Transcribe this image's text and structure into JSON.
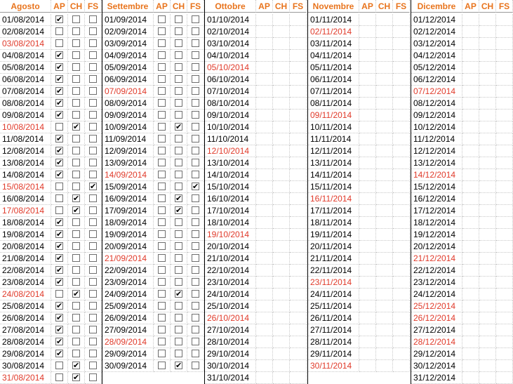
{
  "headers": {
    "months": [
      "Agosto",
      "Settembre",
      "Ottobre",
      "Novembre",
      "Dicembre"
    ],
    "flags": [
      "AP",
      "CH",
      "FS"
    ]
  },
  "colors": {
    "header_text": "#e8741d",
    "holiday_text": "#e03a2a",
    "date_text": "#000000"
  },
  "checkmark_glyph": "✔",
  "months": [
    {
      "name": "Agosto",
      "days": [
        {
          "date": "01/08/2014",
          "holiday": false,
          "checks": [
            true,
            false,
            false
          ]
        },
        {
          "date": "02/08/2014",
          "holiday": false,
          "checks": [
            false,
            false,
            false
          ]
        },
        {
          "date": "03/08/2014",
          "holiday": true,
          "checks": [
            false,
            false,
            false
          ]
        },
        {
          "date": "04/08/2014",
          "holiday": false,
          "checks": [
            true,
            false,
            false
          ]
        },
        {
          "date": "05/08/2014",
          "holiday": false,
          "checks": [
            true,
            false,
            false
          ]
        },
        {
          "date": "06/08/2014",
          "holiday": false,
          "checks": [
            true,
            false,
            false
          ]
        },
        {
          "date": "07/08/2014",
          "holiday": false,
          "checks": [
            true,
            false,
            false
          ]
        },
        {
          "date": "08/08/2014",
          "holiday": false,
          "checks": [
            true,
            false,
            false
          ]
        },
        {
          "date": "09/08/2014",
          "holiday": false,
          "checks": [
            true,
            false,
            false
          ]
        },
        {
          "date": "10/08/2014",
          "holiday": true,
          "checks": [
            false,
            true,
            false
          ]
        },
        {
          "date": "11/08/2014",
          "holiday": false,
          "checks": [
            true,
            false,
            false
          ]
        },
        {
          "date": "12/08/2014",
          "holiday": false,
          "checks": [
            true,
            false,
            false
          ]
        },
        {
          "date": "13/08/2014",
          "holiday": false,
          "checks": [
            true,
            false,
            false
          ]
        },
        {
          "date": "14/08/2014",
          "holiday": false,
          "checks": [
            true,
            false,
            false
          ]
        },
        {
          "date": "15/08/2014",
          "holiday": true,
          "checks": [
            false,
            false,
            true
          ]
        },
        {
          "date": "16/08/2014",
          "holiday": false,
          "checks": [
            false,
            true,
            false
          ]
        },
        {
          "date": "17/08/2014",
          "holiday": true,
          "checks": [
            false,
            true,
            false
          ]
        },
        {
          "date": "18/08/2014",
          "holiday": false,
          "checks": [
            true,
            false,
            false
          ]
        },
        {
          "date": "19/08/2014",
          "holiday": false,
          "checks": [
            true,
            false,
            false
          ]
        },
        {
          "date": "20/08/2014",
          "holiday": false,
          "checks": [
            true,
            false,
            false
          ]
        },
        {
          "date": "21/08/2014",
          "holiday": false,
          "checks": [
            true,
            false,
            false
          ]
        },
        {
          "date": "22/08/2014",
          "holiday": false,
          "checks": [
            true,
            false,
            false
          ]
        },
        {
          "date": "23/08/2014",
          "holiday": false,
          "checks": [
            true,
            false,
            false
          ]
        },
        {
          "date": "24/08/2014",
          "holiday": true,
          "checks": [
            false,
            true,
            false
          ]
        },
        {
          "date": "25/08/2014",
          "holiday": false,
          "checks": [
            true,
            false,
            false
          ]
        },
        {
          "date": "26/08/2014",
          "holiday": false,
          "checks": [
            true,
            false,
            false
          ]
        },
        {
          "date": "27/08/2014",
          "holiday": false,
          "checks": [
            true,
            false,
            false
          ]
        },
        {
          "date": "28/08/2014",
          "holiday": false,
          "checks": [
            true,
            false,
            false
          ]
        },
        {
          "date": "29/08/2014",
          "holiday": false,
          "checks": [
            true,
            false,
            false
          ]
        },
        {
          "date": "30/08/2014",
          "holiday": false,
          "checks": [
            false,
            true,
            false
          ]
        },
        {
          "date": "31/08/2014",
          "holiday": true,
          "checks": [
            false,
            true,
            false
          ]
        }
      ]
    },
    {
      "name": "Settembre",
      "days": [
        {
          "date": "01/09/2014",
          "holiday": false,
          "checks": [
            false,
            false,
            false
          ]
        },
        {
          "date": "02/09/2014",
          "holiday": false,
          "checks": [
            false,
            false,
            false
          ]
        },
        {
          "date": "03/09/2014",
          "holiday": false,
          "checks": [
            false,
            false,
            false
          ]
        },
        {
          "date": "04/09/2014",
          "holiday": false,
          "checks": [
            false,
            false,
            false
          ]
        },
        {
          "date": "05/09/2014",
          "holiday": false,
          "checks": [
            false,
            false,
            false
          ]
        },
        {
          "date": "06/09/2014",
          "holiday": false,
          "checks": [
            false,
            false,
            false
          ]
        },
        {
          "date": "07/09/2014",
          "holiday": true,
          "checks": [
            false,
            false,
            false
          ]
        },
        {
          "date": "08/09/2014",
          "holiday": false,
          "checks": [
            false,
            false,
            false
          ]
        },
        {
          "date": "09/09/2014",
          "holiday": false,
          "checks": [
            false,
            false,
            false
          ]
        },
        {
          "date": "10/09/2014",
          "holiday": false,
          "checks": [
            false,
            true,
            false
          ]
        },
        {
          "date": "11/09/2014",
          "holiday": false,
          "checks": [
            false,
            false,
            false
          ]
        },
        {
          "date": "12/09/2014",
          "holiday": false,
          "checks": [
            false,
            false,
            false
          ]
        },
        {
          "date": "13/09/2014",
          "holiday": false,
          "checks": [
            false,
            false,
            false
          ]
        },
        {
          "date": "14/09/2014",
          "holiday": true,
          "checks": [
            false,
            false,
            false
          ]
        },
        {
          "date": "15/09/2014",
          "holiday": false,
          "checks": [
            false,
            false,
            true
          ]
        },
        {
          "date": "16/09/2014",
          "holiday": false,
          "checks": [
            false,
            true,
            false
          ]
        },
        {
          "date": "17/09/2014",
          "holiday": false,
          "checks": [
            false,
            true,
            false
          ]
        },
        {
          "date": "18/09/2014",
          "holiday": false,
          "checks": [
            false,
            false,
            false
          ]
        },
        {
          "date": "19/09/2014",
          "holiday": false,
          "checks": [
            false,
            false,
            false
          ]
        },
        {
          "date": "20/09/2014",
          "holiday": false,
          "checks": [
            false,
            false,
            false
          ]
        },
        {
          "date": "21/09/2014",
          "holiday": true,
          "checks": [
            false,
            false,
            false
          ]
        },
        {
          "date": "22/09/2014",
          "holiday": false,
          "checks": [
            false,
            false,
            false
          ]
        },
        {
          "date": "23/09/2014",
          "holiday": false,
          "checks": [
            false,
            false,
            false
          ]
        },
        {
          "date": "24/09/2014",
          "holiday": false,
          "checks": [
            false,
            true,
            false
          ]
        },
        {
          "date": "25/09/2014",
          "holiday": false,
          "checks": [
            false,
            false,
            false
          ]
        },
        {
          "date": "26/09/2014",
          "holiday": false,
          "checks": [
            false,
            false,
            false
          ]
        },
        {
          "date": "27/09/2014",
          "holiday": false,
          "checks": [
            false,
            false,
            false
          ]
        },
        {
          "date": "28/09/2014",
          "holiday": true,
          "checks": [
            false,
            false,
            false
          ]
        },
        {
          "date": "29/09/2014",
          "holiday": false,
          "checks": [
            false,
            false,
            false
          ]
        },
        {
          "date": "30/09/2014",
          "holiday": false,
          "checks": [
            false,
            true,
            false
          ]
        }
      ]
    },
    {
      "name": "Ottobre",
      "days": [
        {
          "date": "01/10/2014",
          "holiday": false
        },
        {
          "date": "02/10/2014",
          "holiday": false
        },
        {
          "date": "03/10/2014",
          "holiday": false
        },
        {
          "date": "04/10/2014",
          "holiday": false
        },
        {
          "date": "05/10/2014",
          "holiday": true
        },
        {
          "date": "06/10/2014",
          "holiday": false
        },
        {
          "date": "07/10/2014",
          "holiday": false
        },
        {
          "date": "08/10/2014",
          "holiday": false
        },
        {
          "date": "09/10/2014",
          "holiday": false
        },
        {
          "date": "10/10/2014",
          "holiday": false
        },
        {
          "date": "11/10/2014",
          "holiday": false
        },
        {
          "date": "12/10/2014",
          "holiday": true
        },
        {
          "date": "13/10/2014",
          "holiday": false
        },
        {
          "date": "14/10/2014",
          "holiday": false
        },
        {
          "date": "15/10/2014",
          "holiday": false
        },
        {
          "date": "16/10/2014",
          "holiday": false
        },
        {
          "date": "17/10/2014",
          "holiday": false
        },
        {
          "date": "18/10/2014",
          "holiday": false
        },
        {
          "date": "19/10/2014",
          "holiday": true
        },
        {
          "date": "20/10/2014",
          "holiday": false
        },
        {
          "date": "21/10/2014",
          "holiday": false
        },
        {
          "date": "22/10/2014",
          "holiday": false
        },
        {
          "date": "23/10/2014",
          "holiday": false
        },
        {
          "date": "24/10/2014",
          "holiday": false
        },
        {
          "date": "25/10/2014",
          "holiday": false
        },
        {
          "date": "26/10/2014",
          "holiday": true
        },
        {
          "date": "27/10/2014",
          "holiday": false
        },
        {
          "date": "28/10/2014",
          "holiday": false
        },
        {
          "date": "29/10/2014",
          "holiday": false
        },
        {
          "date": "30/10/2014",
          "holiday": false
        },
        {
          "date": "31/10/2014",
          "holiday": false
        }
      ]
    },
    {
      "name": "Novembre",
      "days": [
        {
          "date": "01/11/2014",
          "holiday": false
        },
        {
          "date": "02/11/2014",
          "holiday": true
        },
        {
          "date": "03/11/2014",
          "holiday": false
        },
        {
          "date": "04/11/2014",
          "holiday": false
        },
        {
          "date": "05/11/2014",
          "holiday": false
        },
        {
          "date": "06/11/2014",
          "holiday": false
        },
        {
          "date": "07/11/2014",
          "holiday": false
        },
        {
          "date": "08/11/2014",
          "holiday": false
        },
        {
          "date": "09/11/2014",
          "holiday": true
        },
        {
          "date": "10/11/2014",
          "holiday": false
        },
        {
          "date": "11/11/2014",
          "holiday": false
        },
        {
          "date": "12/11/2014",
          "holiday": false
        },
        {
          "date": "13/11/2014",
          "holiday": false
        },
        {
          "date": "14/11/2014",
          "holiday": false
        },
        {
          "date": "15/11/2014",
          "holiday": false
        },
        {
          "date": "16/11/2014",
          "holiday": true
        },
        {
          "date": "17/11/2014",
          "holiday": false
        },
        {
          "date": "18/11/2014",
          "holiday": false
        },
        {
          "date": "19/11/2014",
          "holiday": false
        },
        {
          "date": "20/11/2014",
          "holiday": false
        },
        {
          "date": "21/11/2014",
          "holiday": false
        },
        {
          "date": "22/11/2014",
          "holiday": false
        },
        {
          "date": "23/11/2014",
          "holiday": true
        },
        {
          "date": "24/11/2014",
          "holiday": false
        },
        {
          "date": "25/11/2014",
          "holiday": false
        },
        {
          "date": "26/11/2014",
          "holiday": false
        },
        {
          "date": "27/11/2014",
          "holiday": false
        },
        {
          "date": "28/11/2014",
          "holiday": false
        },
        {
          "date": "29/11/2014",
          "holiday": false
        },
        {
          "date": "30/11/2014",
          "holiday": true
        }
      ]
    },
    {
      "name": "Dicembre",
      "days": [
        {
          "date": "01/12/2014",
          "holiday": false
        },
        {
          "date": "02/12/2014",
          "holiday": false
        },
        {
          "date": "03/12/2014",
          "holiday": false
        },
        {
          "date": "04/12/2014",
          "holiday": false
        },
        {
          "date": "05/12/2014",
          "holiday": false
        },
        {
          "date": "06/12/2014",
          "holiday": false
        },
        {
          "date": "07/12/2014",
          "holiday": true
        },
        {
          "date": "08/12/2014",
          "holiday": false
        },
        {
          "date": "09/12/2014",
          "holiday": false
        },
        {
          "date": "10/12/2014",
          "holiday": false
        },
        {
          "date": "11/12/2014",
          "holiday": false
        },
        {
          "date": "12/12/2014",
          "holiday": false
        },
        {
          "date": "13/12/2014",
          "holiday": false
        },
        {
          "date": "14/12/2014",
          "holiday": true
        },
        {
          "date": "15/12/2014",
          "holiday": false
        },
        {
          "date": "16/12/2014",
          "holiday": false
        },
        {
          "date": "17/12/2014",
          "holiday": false
        },
        {
          "date": "18/12/2014",
          "holiday": false
        },
        {
          "date": "19/12/2014",
          "holiday": false
        },
        {
          "date": "20/12/2014",
          "holiday": false
        },
        {
          "date": "21/12/2014",
          "holiday": true
        },
        {
          "date": "22/12/2014",
          "holiday": false
        },
        {
          "date": "23/12/2014",
          "holiday": false
        },
        {
          "date": "24/12/2014",
          "holiday": false
        },
        {
          "date": "25/12/2014",
          "holiday": true
        },
        {
          "date": "26/12/2014",
          "holiday": true
        },
        {
          "date": "27/12/2014",
          "holiday": false
        },
        {
          "date": "28/12/2014",
          "holiday": true
        },
        {
          "date": "29/12/2014",
          "holiday": false
        },
        {
          "date": "30/12/2014",
          "holiday": false
        },
        {
          "date": "31/12/2014",
          "holiday": false
        }
      ]
    }
  ]
}
